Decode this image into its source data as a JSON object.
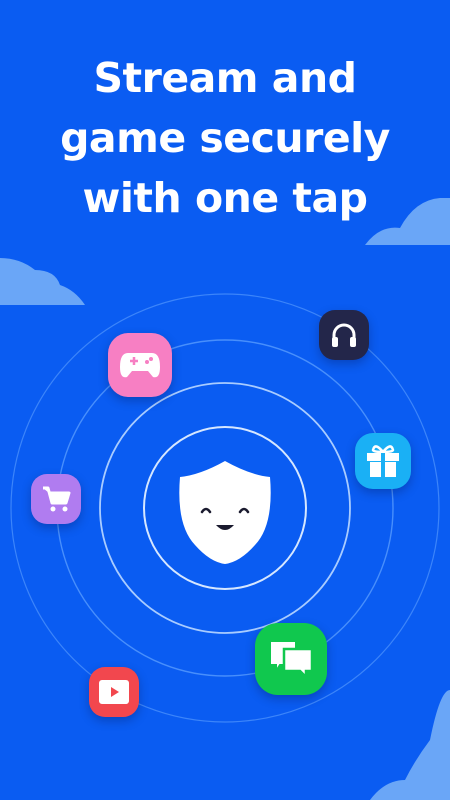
{
  "headline": {
    "lines": [
      "Stream and",
      "game securely",
      "with one tap"
    ]
  },
  "colors": {
    "background": "#0a5cf2",
    "rings": "#5da0ff",
    "cloud": "#6aa6f7",
    "gamepad_tile": "#f77fc3",
    "headphones_tile": "#23264a",
    "gift_tile": "#1ab0f5",
    "cart_tile": "#b07cf0",
    "chat_tile": "#10c84e",
    "video_tile": "#f2474e"
  },
  "apps": [
    {
      "icon": "gamepad-icon"
    },
    {
      "icon": "headphones-icon"
    },
    {
      "icon": "gift-icon"
    },
    {
      "icon": "cart-icon"
    },
    {
      "icon": "chat-icon"
    },
    {
      "icon": "play-video-icon"
    }
  ]
}
